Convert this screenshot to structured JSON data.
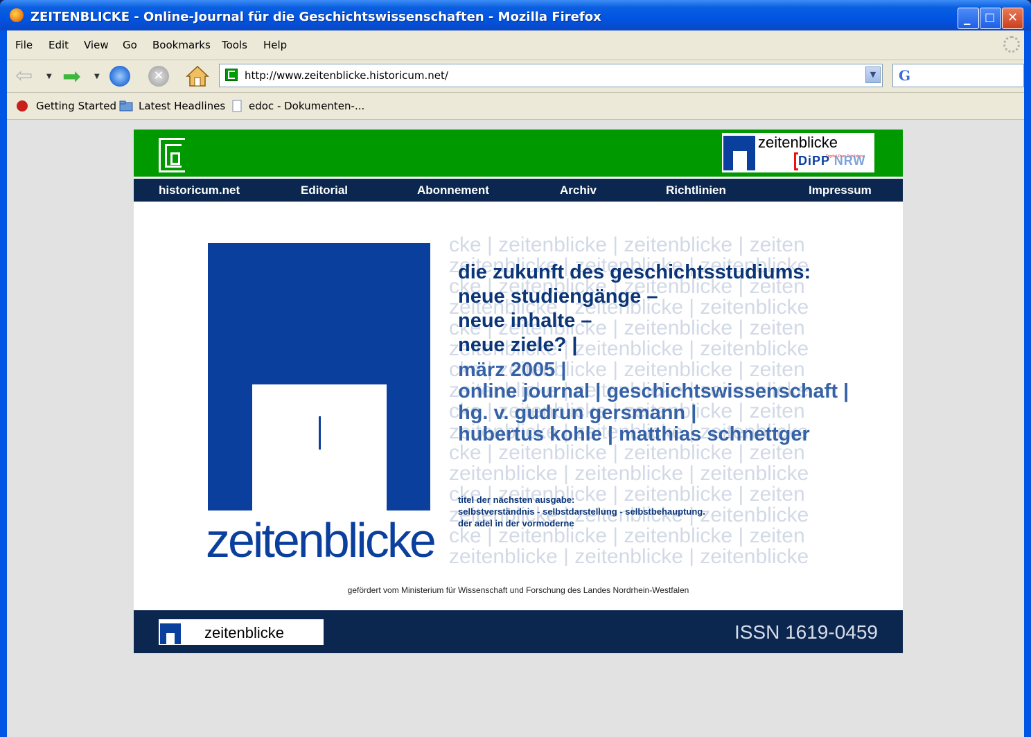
{
  "window": {
    "title": "ZEITENBLICKE - Online-Journal für die Geschichtswissenschaften - Mozilla Firefox"
  },
  "menu": [
    "File",
    "Edit",
    "View",
    "Go",
    "Bookmarks",
    "Tools",
    "Help"
  ],
  "address": {
    "url": "http://www.zeitenblicke.historicum.net/"
  },
  "bookmarks": [
    "Getting Started",
    "Latest Headlines",
    "edoc - Dokumenten-..."
  ],
  "page": {
    "header_badge": {
      "word": "zeitenblicke",
      "dipp": "DiPP",
      "nrw": "NRW",
      "tiny": "Digital Peer Publishing"
    },
    "nav": [
      "historicum.net",
      "Editorial",
      "Abonnement",
      "Archiv",
      "Richtlinien",
      "Impressum"
    ],
    "big_word": "zeitenblicke",
    "headline_dark": [
      "die zukunft des geschichtsstudiums:",
      "neue studiengänge –",
      "neue inhalte –",
      "neue ziele? |"
    ],
    "headline_light": [
      "märz 2005 |",
      "online journal | geschichtswissenschaft |",
      "hg. v. gudrun gersmann |",
      "hubertus kohle | matthias schnettger"
    ],
    "next_issue": [
      "titel der nächsten ausgabe:",
      "selbstverständnis - selbstdarstellung - selbstbehauptung.",
      "der adel in der vormoderne"
    ],
    "pattern_rows": [
      "cke  |  zeitenblicke  |  zeitenblicke  |  zeiten",
      "zeitenblicke  |  zeitenblicke  |  zeitenblicke"
    ],
    "sponsor": "gefördert vom Ministerium für Wissenschaft und Forschung des Landes Nordrhein-Westfalen",
    "footer_word": "zeitenblicke",
    "issn": "ISSN 1619-0459"
  }
}
